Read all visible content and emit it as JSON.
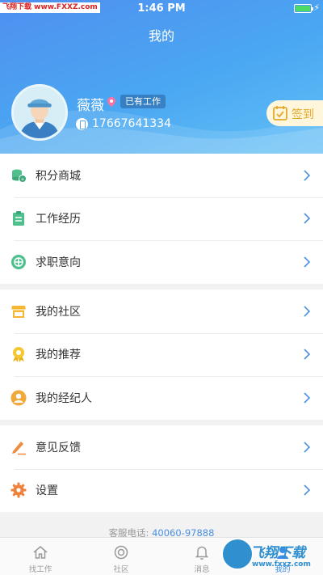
{
  "status_bar": {
    "watermark": "飞翔下载 www.FXXZ.com",
    "time": "1:46 PM",
    "battery_level": 1.0,
    "battery_color": "#4cd964"
  },
  "header": {
    "title": "我的",
    "gradient_colors": [
      "#4f8ff0",
      "#62c0f6"
    ]
  },
  "profile": {
    "name": "薇薇",
    "location_icon": "location-pin-icon",
    "job_status": "已有工作",
    "phone": "17667641334",
    "sign_in_label": "签到",
    "sign_in_color": "#e4a92b"
  },
  "menu_groups": [
    [
      {
        "icon": "coins-icon",
        "label": "积分商城"
      },
      {
        "icon": "clipboard-icon",
        "label": "工作经历"
      },
      {
        "icon": "target-icon",
        "label": "求职意向"
      }
    ],
    [
      {
        "icon": "shop-icon",
        "label": "我的社区"
      },
      {
        "icon": "medal-icon",
        "label": "我的推荐"
      },
      {
        "icon": "agent-icon",
        "label": "我的经纪人"
      }
    ],
    [
      {
        "icon": "pen-icon",
        "label": "意见反馈"
      },
      {
        "icon": "gear-icon",
        "label": "设置"
      }
    ]
  ],
  "service": {
    "label": "客服电话:",
    "number": "40060-97888"
  },
  "tabbar": {
    "tabs": [
      {
        "icon": "home-icon",
        "label": "找工作",
        "active": false
      },
      {
        "icon": "community-icon",
        "label": "社区",
        "active": false
      },
      {
        "icon": "bell-icon",
        "label": "消息",
        "active": false
      },
      {
        "icon": "person-icon",
        "label": "我的",
        "active": true
      }
    ],
    "accent_color": "#3a8ee6"
  },
  "watermark_badge": {
    "title": "飞翔下载",
    "url": "www.fxxz.com"
  }
}
